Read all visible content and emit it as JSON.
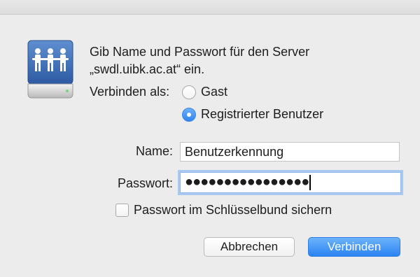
{
  "dialog": {
    "message_line1": "Gib Name und Passwort für den Server",
    "message_line2": "„swdl.uibk.ac.at“ ein.",
    "icon": "server-share-icon",
    "connect_as_label": "Verbinden als:",
    "connect_as_options": [
      {
        "label": "Gast",
        "selected": false
      },
      {
        "label": "Registrierter Benutzer",
        "selected": true
      }
    ],
    "name_label": "Name:",
    "name_value": "Benutzerkennung",
    "password_label": "Passwort:",
    "password_masked": "●●●●●●●●●●●●●●●●",
    "keychain_label": "Passwort im Schlüsselbund sichern",
    "keychain_checked": false,
    "cancel_label": "Abbrechen",
    "connect_label": "Verbinden"
  },
  "colors": {
    "accent": "#2f84f0",
    "focus_ring": "#a9c9f0",
    "background": "#ececec"
  }
}
